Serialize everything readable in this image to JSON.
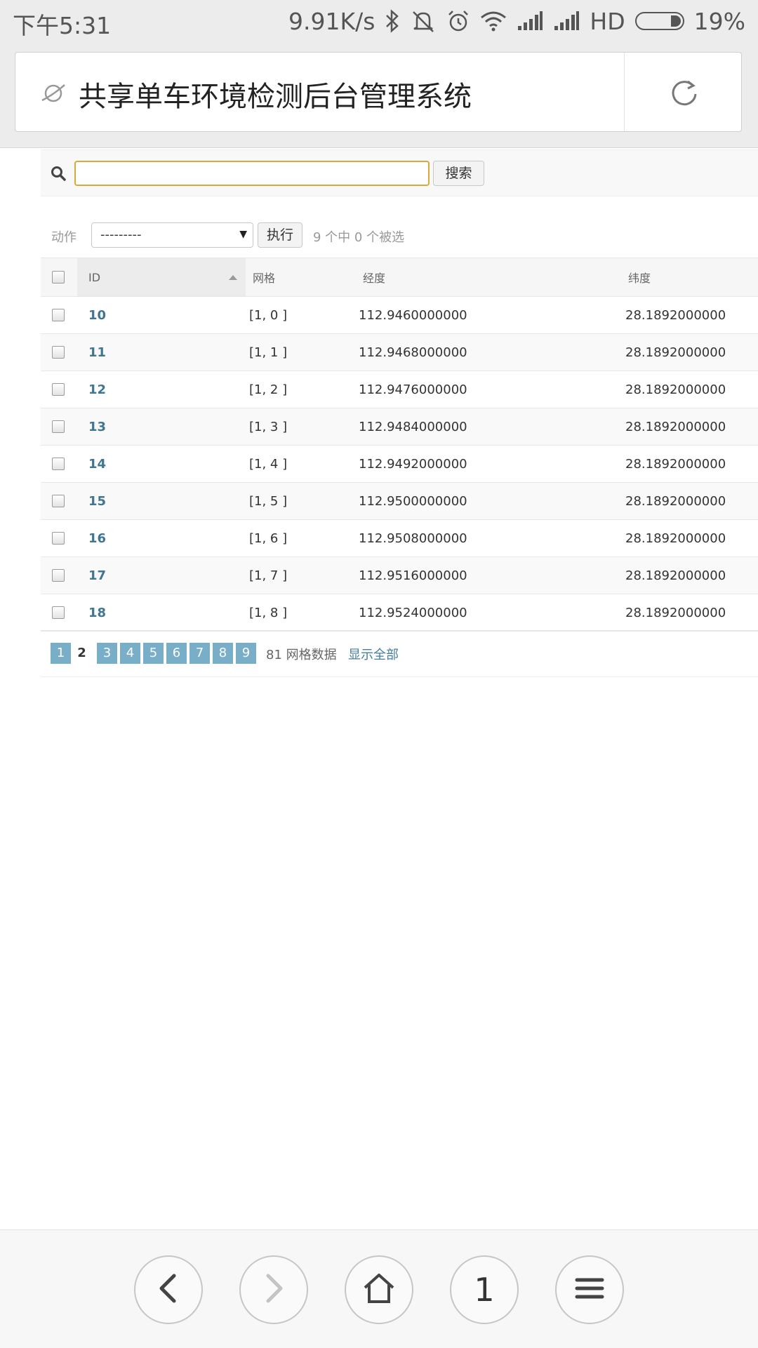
{
  "status_bar": {
    "time": "下午5:31",
    "speed": "9.91K/s",
    "network": "HD",
    "battery": "19%",
    "battery_level": 0.19,
    "icons": [
      "bluetooth-icon",
      "mute-icon",
      "alarm-icon",
      "wifi-icon",
      "signal-icon",
      "signal-icon"
    ]
  },
  "browser": {
    "page_title": "共享单车环境检测后台管理系统",
    "tab_count": "1",
    "icons": {
      "site": "planet-icon",
      "reload": "reload-icon"
    }
  },
  "search": {
    "value": "",
    "placeholder": "",
    "button_label": "搜索"
  },
  "actions": {
    "label": "动作",
    "selected": "---------",
    "execute_label": "执行",
    "selection_count": "9 个中 0 个被选"
  },
  "table": {
    "columns": [
      "ID",
      "网格",
      "经度",
      "纬度"
    ],
    "sorted_column": "ID",
    "rows": [
      {
        "id": "10",
        "grid": "[1, 0 ]",
        "lng": "112.9460000000",
        "lat": "28.1892000000"
      },
      {
        "id": "11",
        "grid": "[1, 1 ]",
        "lng": "112.9468000000",
        "lat": "28.1892000000"
      },
      {
        "id": "12",
        "grid": "[1, 2 ]",
        "lng": "112.9476000000",
        "lat": "28.1892000000"
      },
      {
        "id": "13",
        "grid": "[1, 3 ]",
        "lng": "112.9484000000",
        "lat": "28.1892000000"
      },
      {
        "id": "14",
        "grid": "[1, 4 ]",
        "lng": "112.9492000000",
        "lat": "28.1892000000"
      },
      {
        "id": "15",
        "grid": "[1, 5 ]",
        "lng": "112.9500000000",
        "lat": "28.1892000000"
      },
      {
        "id": "16",
        "grid": "[1, 6 ]",
        "lng": "112.9508000000",
        "lat": "28.1892000000"
      },
      {
        "id": "17",
        "grid": "[1, 7 ]",
        "lng": "112.9516000000",
        "lat": "28.1892000000"
      },
      {
        "id": "18",
        "grid": "[1, 8 ]",
        "lng": "112.9524000000",
        "lat": "28.1892000000"
      }
    ]
  },
  "paginator": {
    "pages": [
      "1",
      "2",
      "3",
      "4",
      "5",
      "6",
      "7",
      "8",
      "9"
    ],
    "current": "2",
    "count_text": "81 网格数据",
    "show_all": "显示全部"
  },
  "colors": {
    "link": "#417690",
    "page_bg": "#79aec8",
    "search_focus": "#d9a93a"
  }
}
